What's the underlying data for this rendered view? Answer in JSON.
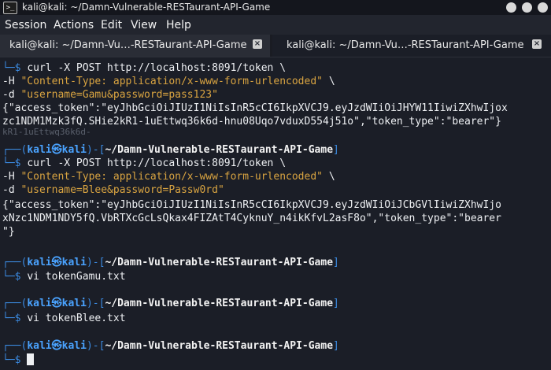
{
  "window": {
    "title": "kali@kali: ~/Damn-Vulnerable-RESTaurant-API-Game",
    "terminal_icon": "terminal-icon"
  },
  "menu": [
    "Session",
    "Actions",
    "Edit",
    "View",
    "Help"
  ],
  "tabs": [
    {
      "label": "kali@kali: ~/Damn-Vu…-RESTaurant-API-Game",
      "active": false
    },
    {
      "label": "kali@kali: ~/Damn-Vu…-RESTaurant-API-Game",
      "active": true
    }
  ],
  "prompt": {
    "user": "kali",
    "host": "kali",
    "dir": "~/Damn-Vulnerable-RESTaurant-API-Game"
  },
  "terminal": {
    "cmd1": "curl -X POST http://localhost:8091/token \\",
    "h1": "\"Content-Type: application/x-www-form-urlencoded\"",
    "d1": "\"username=Gamu&password=pass123\"",
    "out1a": "{\"access_token\":\"eyJhbGciOiJIUzI1NiIsInR5cCI6IkpXVCJ9.eyJzdWIiOiJHYW11IiwiZXhwIjox",
    "out1b": "zc1NDM1Mzk3fQ.SHie2kR1-1uEttwq36k6d-hnu08Uqo7vduxD554j51o\",\"token_type\":\"bearer\"}",
    "ghost": "kR1-1uEttwq36k6d-",
    "cmd2": "curl -X POST http://localhost:8091/token \\",
    "h2": "\"Content-Type: application/x-www-form-urlencoded\"",
    "d2": "\"username=Blee&password=Passw0rd\"",
    "out2a": "{\"access_token\":\"eyJhbGciOiJIUzI1NiIsInR5cCI6IkpXVCJ9.eyJzdWIiOiJCbGVlIiwiZXhwIjo",
    "out2b": "xNzc1NDM1NDY5fQ.VbRTXcGcLsQkax4FIZAtT4CyknuY_n4ikKfvL2asF8o\",\"token_type\":\"bearer",
    "out2c": "\"}",
    "cmd3": "vi tokenGamu.txt",
    "cmd4": "vi tokenBlee.txt",
    "flag_h": "-H",
    "flag_d": "-d",
    "backslash": "\\"
  },
  "colors": {
    "bg": "#1b1e27",
    "prompt_blue": "#3b8ae0",
    "string_orange": "#d9a441"
  }
}
